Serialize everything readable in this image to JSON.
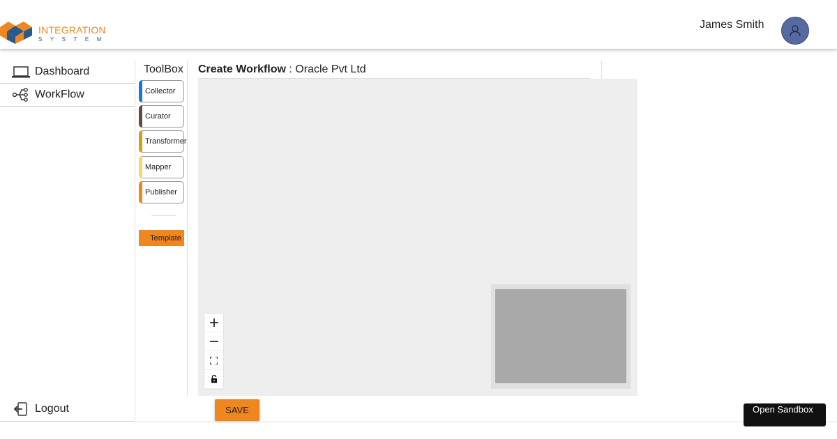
{
  "header": {
    "logo_line1": "INTEGRATION",
    "logo_line2": "SYSTEM",
    "user_name": "James Smith"
  },
  "sidebar": {
    "items": [
      {
        "label": "Dashboard",
        "icon": "laptop-icon"
      },
      {
        "label": "WorkFlow",
        "icon": "workflow-icon"
      }
    ],
    "logout": {
      "label": "Logout",
      "icon": "logout-icon"
    }
  },
  "toolbox": {
    "title": "ToolBox",
    "tools": [
      {
        "label": "Collector",
        "color": "#1a73e8"
      },
      {
        "label": "Curator",
        "color": "#5d4e44"
      },
      {
        "label": "Transformer",
        "color": "#d4a017"
      },
      {
        "label": "Mapper",
        "color": "#f5d76e"
      },
      {
        "label": "Publisher",
        "color": "#f0861e"
      }
    ],
    "template_label": "Template"
  },
  "workflow": {
    "title": "Create Workflow",
    "separator": " : ",
    "org_name": "Oracle Pvt Ltd",
    "controls": [
      "zoom-in-icon",
      "zoom-out-icon",
      "fit-view-icon",
      "lock-icon"
    ]
  },
  "actions": {
    "save_label": "SAVE",
    "sandbox_label": "Open Sandbox"
  },
  "colors": {
    "accent": "#f0861e",
    "brand_blue": "#2b5a8a",
    "canvas_bg": "#eeeeee"
  }
}
